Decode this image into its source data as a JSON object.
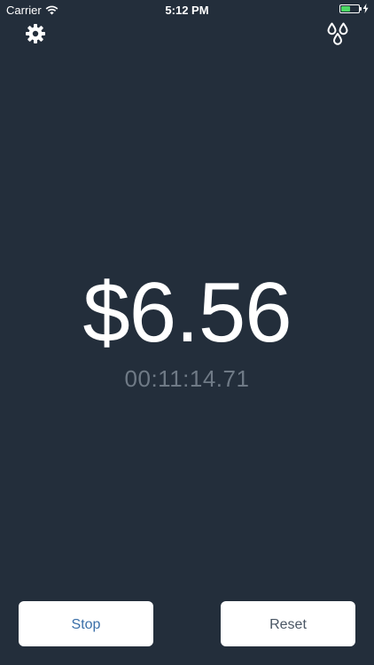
{
  "status_bar": {
    "carrier": "Carrier",
    "time": "5:12 PM",
    "battery_level": 0.5,
    "battery_color": "#4cd964",
    "wifi_icon": "wifi-icon",
    "charging_icon": "bolt-icon"
  },
  "toolbar": {
    "settings_icon": "gear-icon",
    "theme_icon": "drops-icon"
  },
  "meter": {
    "amount": "$6.56",
    "elapsed": "00:11:14.71"
  },
  "controls": {
    "stop_label": "Stop",
    "reset_label": "Reset"
  },
  "colors": {
    "background": "#232e3b",
    "amount_text": "#ffffff",
    "elapsed_text": "#6f7a86",
    "stop_text": "#3a6fa8",
    "reset_text": "#4a5664",
    "button_bg": "#ffffff"
  }
}
